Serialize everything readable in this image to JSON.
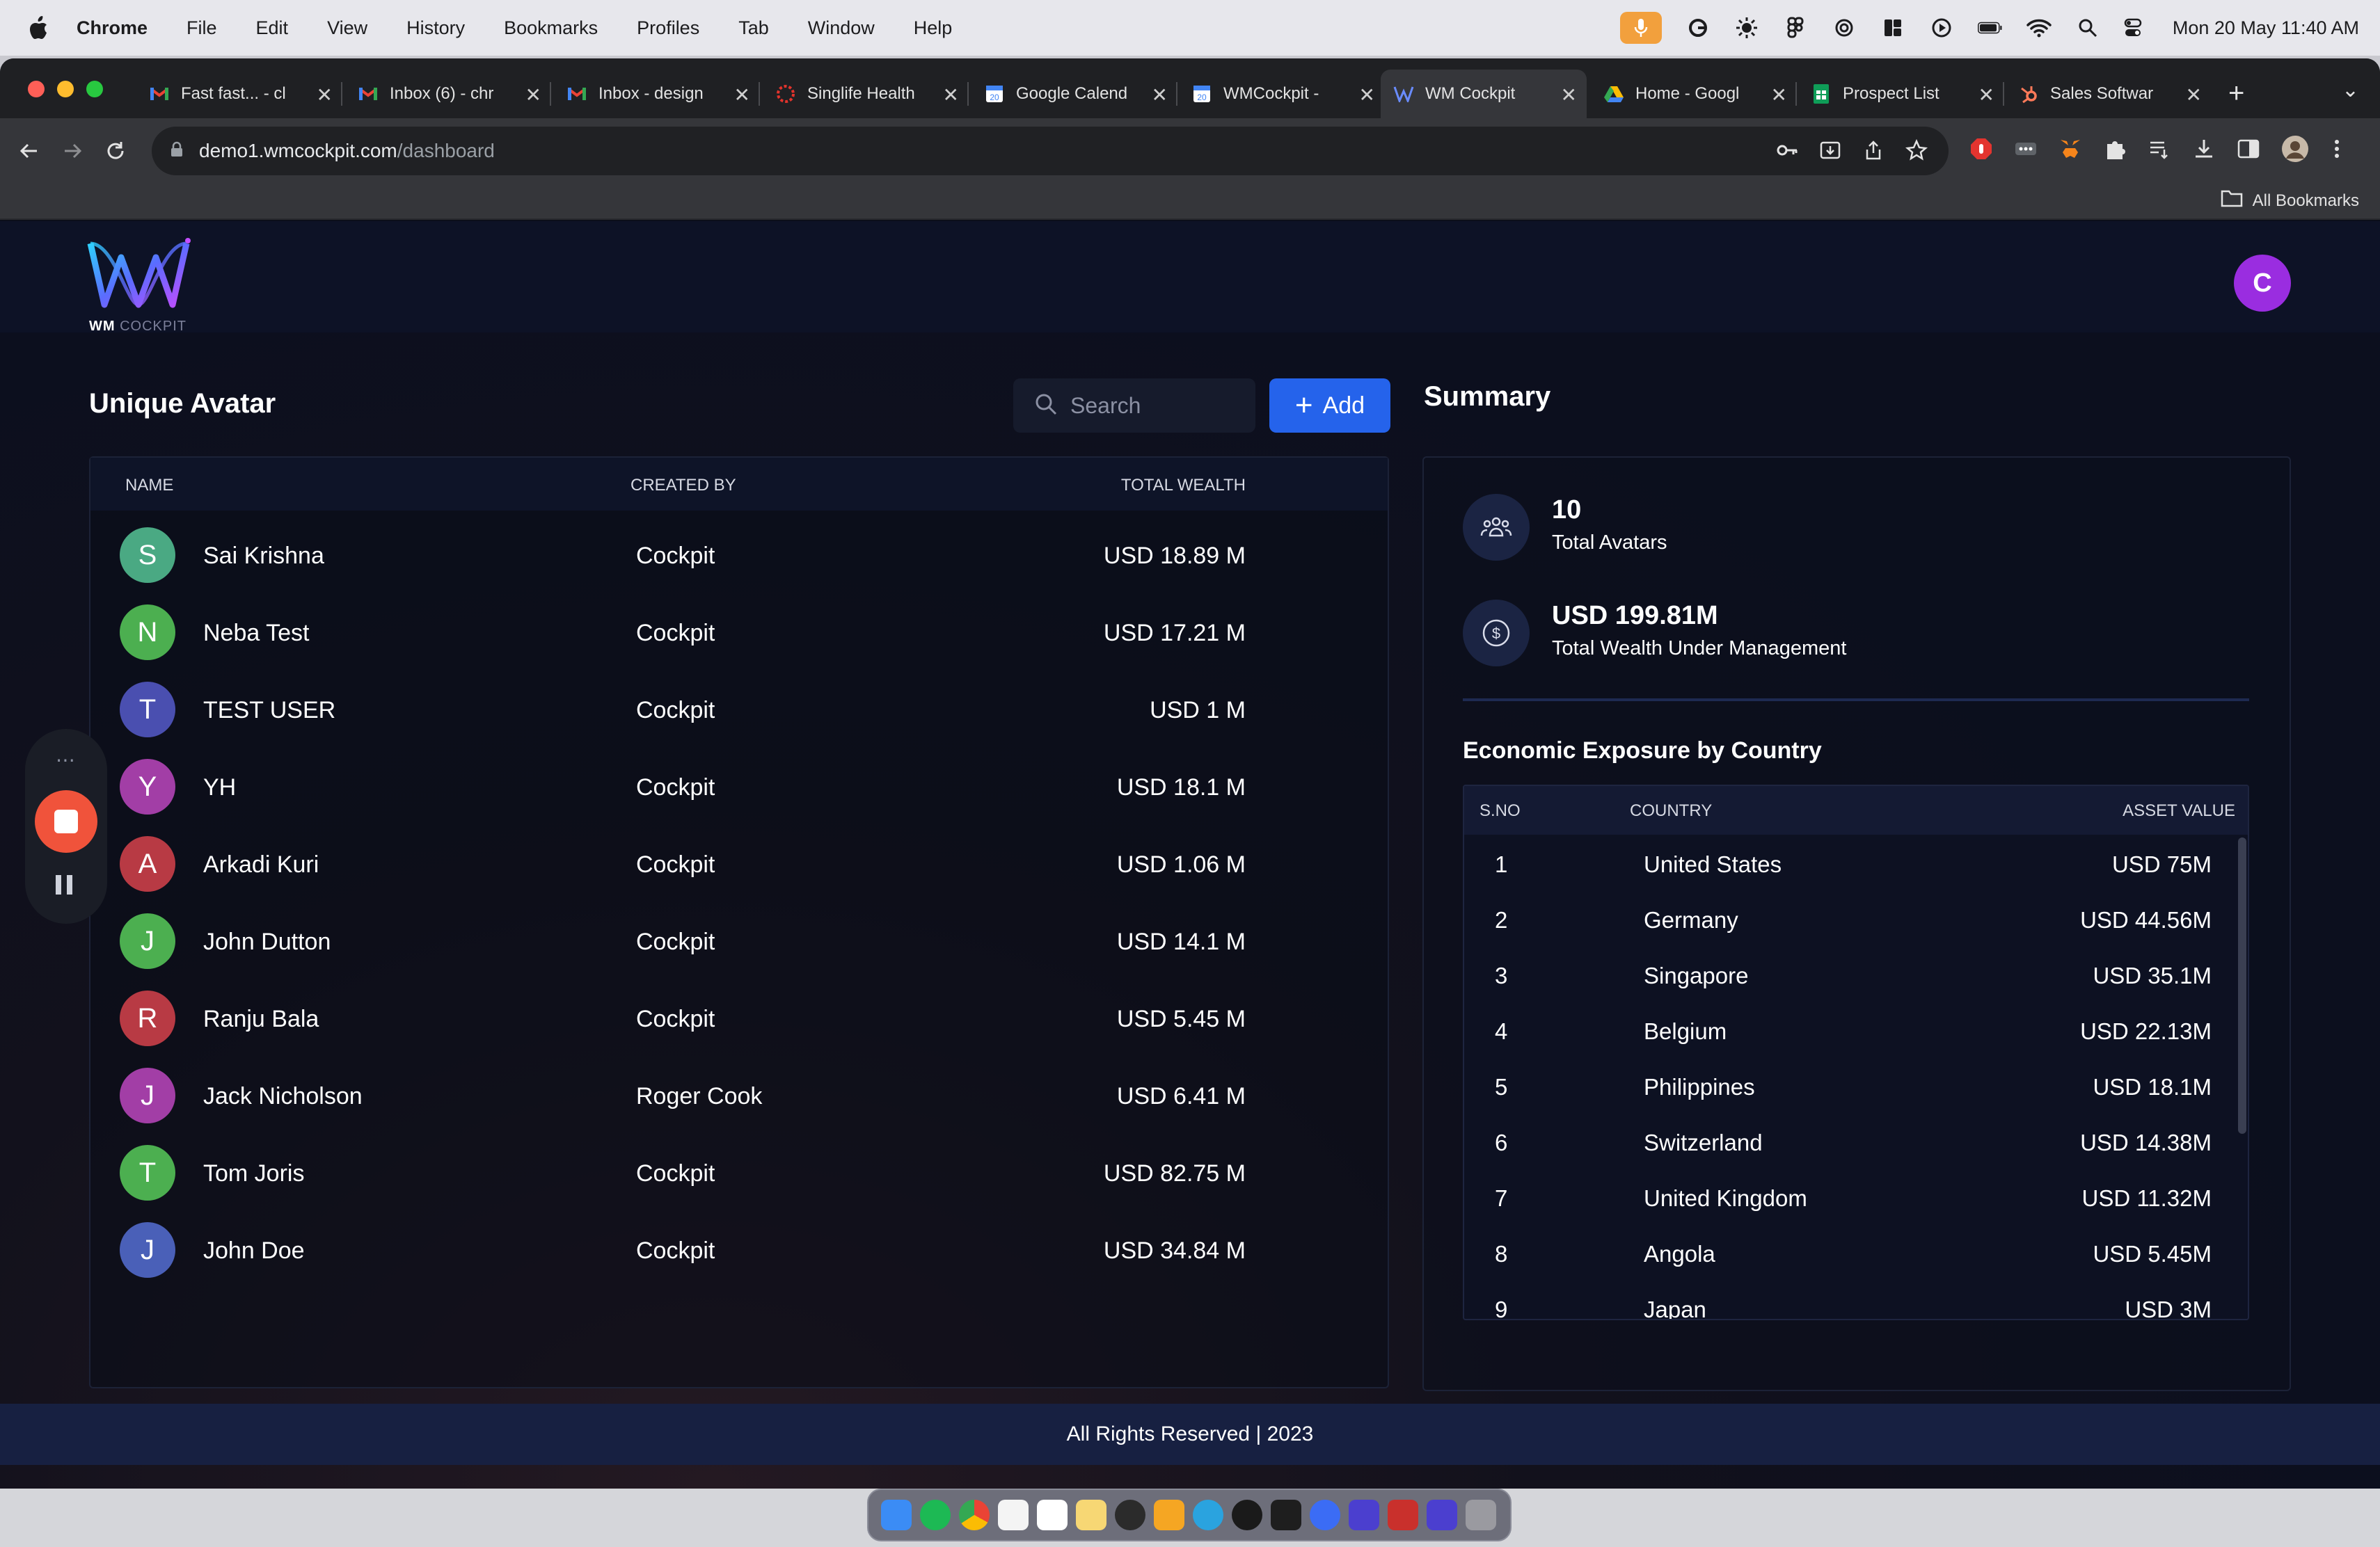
{
  "menubar": {
    "app_name": "Chrome",
    "items": [
      "File",
      "Edit",
      "View",
      "History",
      "Bookmarks",
      "Profiles",
      "Tab",
      "Window",
      "Help"
    ],
    "clock": "Mon 20 May  11:40 AM"
  },
  "browser": {
    "tabs": [
      {
        "title": "Fast fast... - cl",
        "icon": "gmail-icon"
      },
      {
        "title": "Inbox (6) - chr",
        "icon": "gmail-icon"
      },
      {
        "title": "Inbox - design",
        "icon": "gmail-icon"
      },
      {
        "title": "Singlife Health",
        "icon": "singlife-icon"
      },
      {
        "title": "Google Calend",
        "icon": "calendar-icon"
      },
      {
        "title": "WMCockpit - ",
        "icon": "calendar-icon"
      },
      {
        "title": "WM Cockpit",
        "icon": "wm-icon",
        "active": true
      },
      {
        "title": "Home - Googl",
        "icon": "drive-icon"
      },
      {
        "title": "Prospect List",
        "icon": "sheets-icon"
      },
      {
        "title": "Sales Softwar",
        "icon": "hubspot-icon"
      }
    ],
    "url_host": "demo1.wmcockpit.com",
    "url_path": "/dashboard",
    "all_bookmarks": "All Bookmarks"
  },
  "app": {
    "logo_brand": "WM",
    "logo_sub": "COCKPIT",
    "user_initial": "C",
    "avatars_title": "Unique Avatar",
    "search_placeholder": "Search",
    "add_label": "Add",
    "avatar_columns": [
      "NAME",
      "CREATED BY",
      "TOTAL WEALTH"
    ],
    "avatars": [
      {
        "initial": "S",
        "name": "Sai Krishna",
        "created_by": "Cockpit",
        "wealth": "USD 18.89 M",
        "color": "#4aa983"
      },
      {
        "initial": "N",
        "name": "Neba Test",
        "created_by": "Cockpit",
        "wealth": "USD 17.21 M",
        "color": "#4caf50"
      },
      {
        "initial": "T",
        "name": "TEST USER",
        "created_by": "Cockpit",
        "wealth": "USD 1 M",
        "color": "#4a4fb0"
      },
      {
        "initial": "Y",
        "name": "YH",
        "created_by": "Cockpit",
        "wealth": "USD 18.1 M",
        "color": "#a23ea6"
      },
      {
        "initial": "A",
        "name": "Arkadi Kuri",
        "created_by": "Cockpit",
        "wealth": "USD 1.06 M",
        "color": "#b83a44"
      },
      {
        "initial": "J",
        "name": "John Dutton",
        "created_by": "Cockpit",
        "wealth": "USD 14.1 M",
        "color": "#4caf50"
      },
      {
        "initial": "R",
        "name": "Ranju Bala",
        "created_by": "Cockpit",
        "wealth": "USD 5.45 M",
        "color": "#b83a44"
      },
      {
        "initial": "J",
        "name": "Jack Nicholson",
        "created_by": "Roger Cook",
        "wealth": "USD 6.41 M",
        "color": "#a23ea6"
      },
      {
        "initial": "T",
        "name": "Tom Joris",
        "created_by": "Cockpit",
        "wealth": "USD 82.75 M",
        "color": "#4caf50"
      },
      {
        "initial": "J",
        "name": "John Doe",
        "created_by": "Cockpit",
        "wealth": "USD 34.84 M",
        "color": "#4a60b8"
      }
    ],
    "summary_title": "Summary",
    "total_avatars_value": "10",
    "total_avatars_label": "Total Avatars",
    "total_wealth_value": "USD 199.81M",
    "total_wealth_label": "Total Wealth Under Management",
    "exposure_title": "Economic Exposure by Country",
    "exposure_columns": [
      "S.NO",
      "COUNTRY",
      "ASSET VALUE"
    ],
    "exposure": [
      {
        "sno": "1",
        "country": "United States",
        "value": "USD  75M"
      },
      {
        "sno": "2",
        "country": "Germany",
        "value": "USD  44.56M"
      },
      {
        "sno": "3",
        "country": "Singapore",
        "value": "USD  35.1M"
      },
      {
        "sno": "4",
        "country": "Belgium",
        "value": "USD  22.13M"
      },
      {
        "sno": "5",
        "country": "Philippines",
        "value": "USD  18.1M"
      },
      {
        "sno": "6",
        "country": "Switzerland",
        "value": "USD  14.38M"
      },
      {
        "sno": "7",
        "country": "United Kingdom",
        "value": "USD  11.32M"
      },
      {
        "sno": "8",
        "country": "Angola",
        "value": "USD  5.45M"
      },
      {
        "sno": "9",
        "country": "Japan",
        "value": "USD  3M"
      }
    ],
    "footer": "All Rights Reserved | 2023"
  },
  "colors": {
    "accent": "#2563eb",
    "user_avatar": "#9a2de0",
    "record": "#f0533b"
  }
}
